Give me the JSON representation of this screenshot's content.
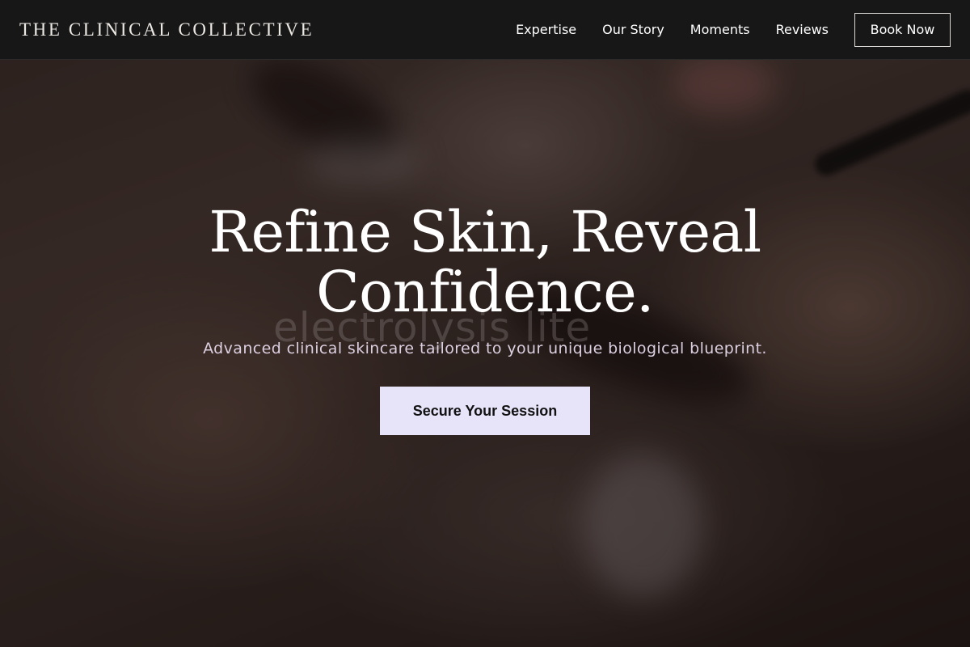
{
  "brand": {
    "name": "THE CLINICAL COLLECTIVE"
  },
  "nav": {
    "links": [
      {
        "label": "Expertise"
      },
      {
        "label": "Our Story"
      },
      {
        "label": "Moments"
      },
      {
        "label": "Reviews"
      }
    ],
    "book_label": "Book Now"
  },
  "hero": {
    "headline_line1": "Refine Skin, Reveal",
    "headline_line2": "Confidence.",
    "watermark_text": "electrolysis lite",
    "subheadline": "Advanced clinical skincare tailored to your unique biological blueprint.",
    "cta_label": "Secure Your Session"
  },
  "colors": {
    "nav_background": "#181717",
    "cta_background": "#e7e3f9",
    "subheadline_text": "#dccfe0",
    "headline_text": "#ffffff"
  }
}
